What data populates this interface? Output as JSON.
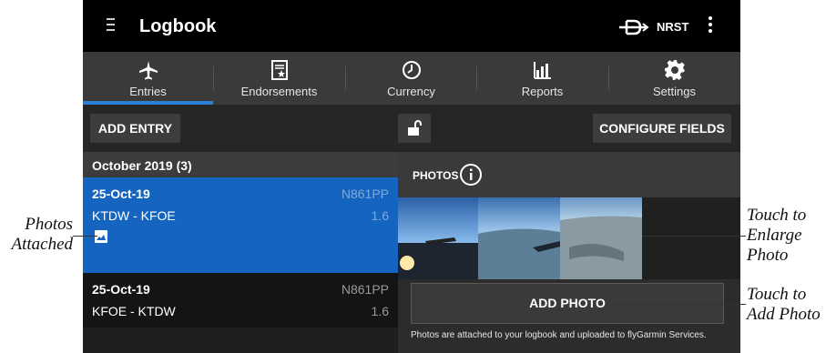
{
  "app": {
    "title": "Logbook",
    "nrst_label": "NRST"
  },
  "tabs": [
    {
      "label": "Entries",
      "icon": "airplane-icon",
      "active": true
    },
    {
      "label": "Endorsements",
      "icon": "document-star-icon",
      "active": false
    },
    {
      "label": "Currency",
      "icon": "clock-icon",
      "active": false
    },
    {
      "label": "Reports",
      "icon": "bar-chart-icon",
      "active": false
    },
    {
      "label": "Settings",
      "icon": "gear-icon",
      "active": false
    }
  ],
  "toolbar": {
    "add_entry_label": "ADD ENTRY",
    "configure_label": "CONFIGURE FIELDS",
    "lock_icon": "unlock-icon"
  },
  "list": {
    "section_header": "October 2019 (3)",
    "entries": [
      {
        "date": "25-Oct-19",
        "tail": "N861PP",
        "route": "KTDW - KFOE",
        "time": "1.6",
        "has_photo": true,
        "selected": true
      },
      {
        "date": "25-Oct-19",
        "tail": "N861PP",
        "route": "KFOE - KTDW",
        "time": "1.6",
        "has_photo": false,
        "selected": false
      }
    ]
  },
  "photos": {
    "header": "PHOTOS",
    "add_label": "ADD PHOTO",
    "note": "Photos are attached to your logbook and uploaded to flyGarmin Services."
  },
  "callouts": {
    "photos_attached_line1": "Photos",
    "photos_attached_line2": "Attached",
    "enlarge_line1": "Touch to",
    "enlarge_line2": "Enlarge",
    "enlarge_line3": "Photo",
    "add_line1": "Touch to",
    "add_line2": "Add Photo"
  },
  "colors": {
    "accent": "#2a7fd6",
    "selected_row": "#1565c0",
    "background": "#1b1b1b"
  }
}
